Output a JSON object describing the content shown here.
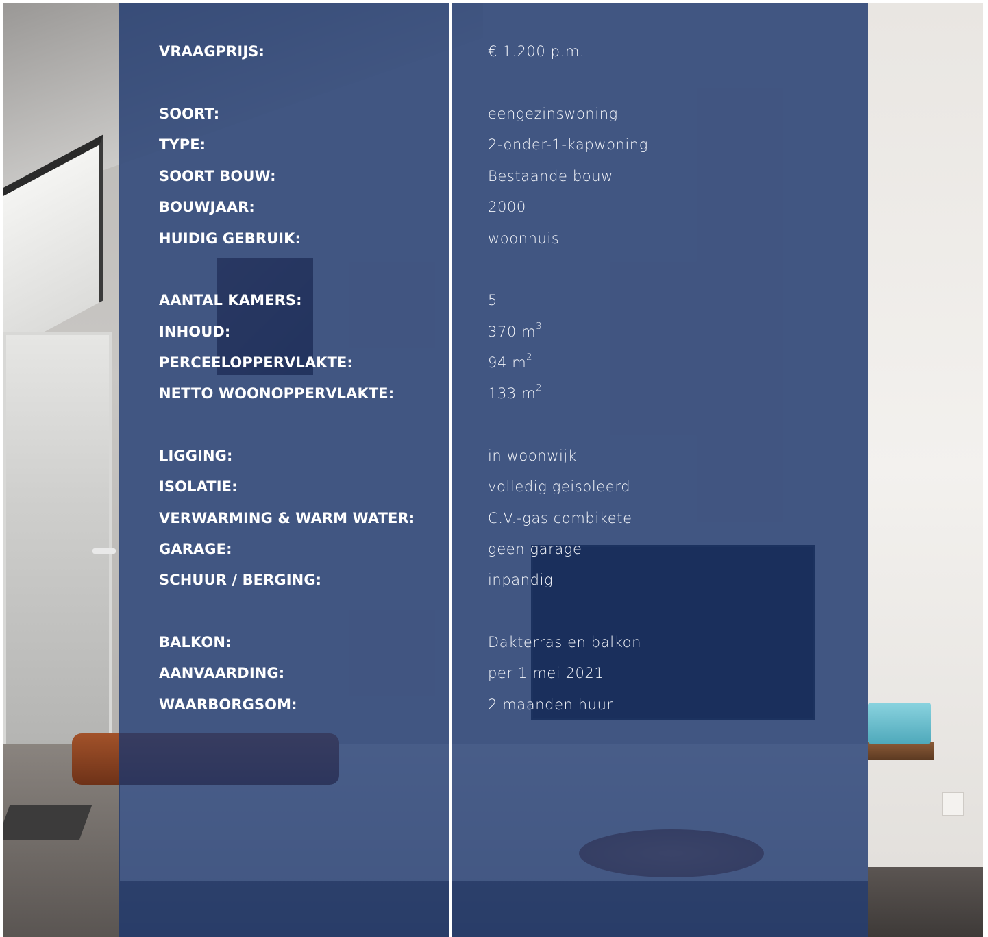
{
  "specs": [
    {
      "label": "VRAAGPRIJS:",
      "value": "€ 1.200 p.m."
    },
    {
      "label": "SOORT:",
      "value": "eengezinswoning"
    },
    {
      "label": "TYPE:",
      "value": "2-onder-1-kapwoning"
    },
    {
      "label": "SOORT BOUW:",
      "value": "Bestaande bouw"
    },
    {
      "label": "BOUWJAAR:",
      "value": "2000"
    },
    {
      "label": "HUIDIG GEBRUIK:",
      "value": "woonhuis"
    },
    {
      "label": "AANTAL KAMERS:",
      "value": "5"
    },
    {
      "label": "INHOUD:",
      "value": "370 m",
      "unit_sup": "3"
    },
    {
      "label": "PERCEELOPPERVLAKTE:",
      "value": "94 m",
      "unit_sup": "2"
    },
    {
      "label": "NETTO WOONOPPERVLAKTE:",
      "value": "133 m",
      "unit_sup": "2"
    },
    {
      "label": "LIGGING:",
      "value": "in woonwijk"
    },
    {
      "label": "ISOLATIE:",
      "value": "volledig geisoleerd"
    },
    {
      "label": "VERWARMING & WARM WATER:",
      "value": "C.V.-gas combiketel"
    },
    {
      "label": "GARAGE:",
      "value": "geen garage"
    },
    {
      "label": "SCHUUR / BERGING:",
      "value": "inpandig"
    },
    {
      "label": "BALKON:",
      "value": "Dakterras en balkon"
    },
    {
      "label": "AANVAARDING:",
      "value": "per 1 mei 2021"
    },
    {
      "label": "WAARBORGSOM:",
      "value": "2 maanden huur"
    }
  ],
  "colors": {
    "panel_overlay": "#1d376e",
    "text": "#ffffff",
    "divider": "#ffffff"
  }
}
